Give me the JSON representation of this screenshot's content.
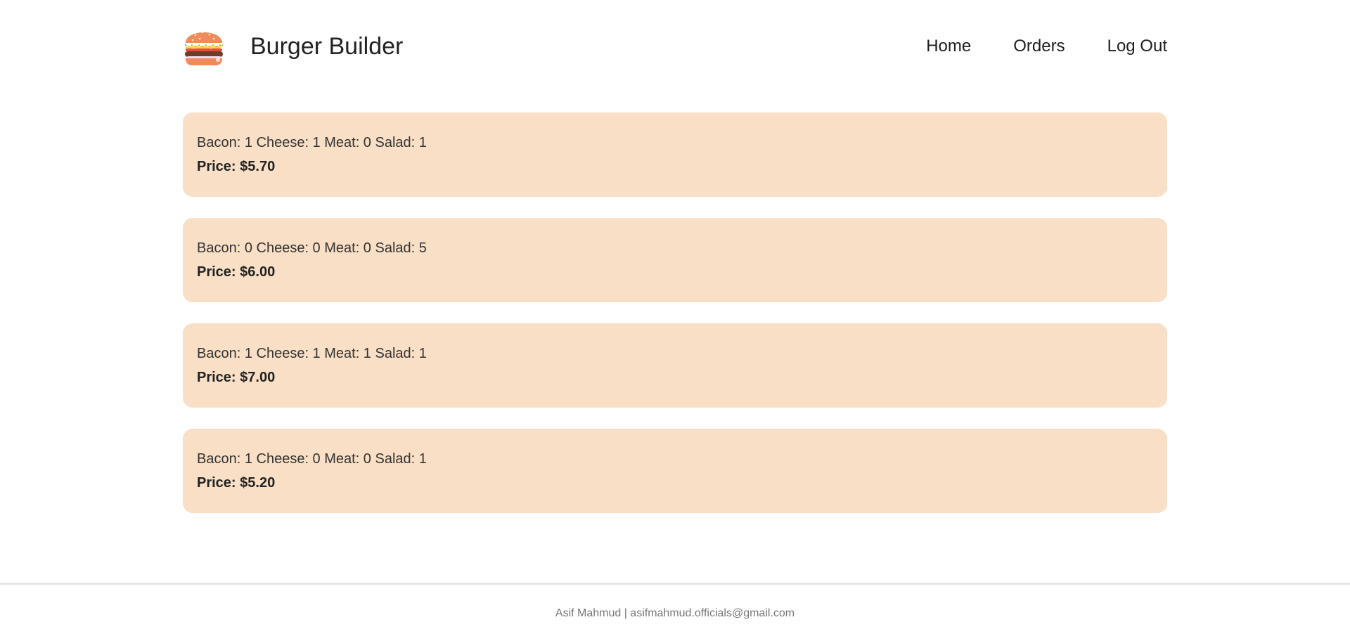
{
  "header": {
    "brand_title": "Burger Builder",
    "logo_icon": "burger-icon",
    "nav": [
      {
        "label": "Home"
      },
      {
        "label": "Orders"
      },
      {
        "label": "Log Out"
      }
    ]
  },
  "orders": [
    {
      "ingredients": "Bacon: 1 Cheese: 1 Meat: 0 Salad: 1",
      "price": "Price: $5.70"
    },
    {
      "ingredients": "Bacon: 0 Cheese: 0 Meat: 0 Salad: 5",
      "price": "Price: $6.00"
    },
    {
      "ingredients": "Bacon: 1 Cheese: 1 Meat: 1 Salad: 1",
      "price": "Price: $7.00"
    },
    {
      "ingredients": "Bacon: 1 Cheese: 0 Meat: 0 Salad: 1",
      "price": "Price: $5.20"
    }
  ],
  "footer": {
    "text": "Asif Mahmud | asifmahmud.officials@gmail.com"
  },
  "colors": {
    "card_background": "#f9dfc5",
    "background": "#ffffff",
    "footer_text": "#777777"
  }
}
